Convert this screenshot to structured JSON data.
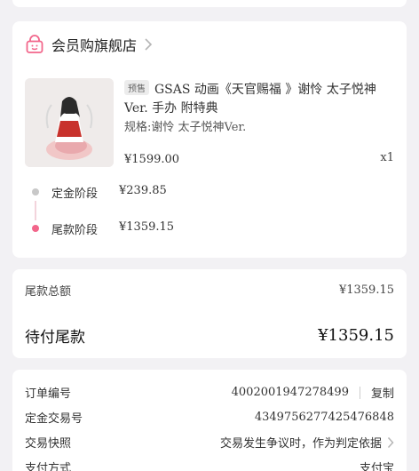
{
  "shop": {
    "name": "会员购旗舰店"
  },
  "product": {
    "badge": "预售",
    "title": "GSAS 动画《天官赐福 》谢怜 太子悦神Ver. 手办 附特典",
    "spec": "规格:谢怜 太子悦神Ver.",
    "price": "¥1599.00",
    "quantity": "x1"
  },
  "stages": [
    {
      "label": "定金阶段",
      "amount": "¥239.85",
      "dot_color": "#c8c8c8"
    },
    {
      "label": "尾款阶段",
      "amount": "¥1359.15",
      "dot_color": "#f2668b"
    }
  ],
  "balance": {
    "total_label": "尾款总额",
    "total_value": "¥1359.15",
    "pending_label": "待付尾款",
    "pending_value": "¥1359.15"
  },
  "info": {
    "order_no_label": "订单编号",
    "order_no": "4002001947278499",
    "copy_label": "复制",
    "deposit_txn_label": "定金交易号",
    "deposit_txn": "4349756277425476848",
    "snapshot_label": "交易快照",
    "snapshot_text": "交易发生争议时，作为判定依据",
    "payment_label": "支付方式",
    "payment_value": "支付宝"
  },
  "colors": {
    "accent": "#f2668b",
    "background": "#f2f1f4"
  }
}
